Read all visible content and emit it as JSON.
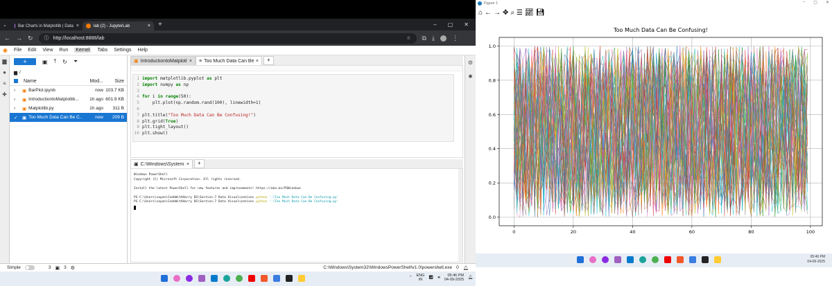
{
  "browser": {
    "tabs": [
      {
        "title": "Bar Charts in Matplotlib | Data",
        "active": false
      },
      {
        "title": "lab (2) - JupyterLab",
        "active": true
      }
    ],
    "new_tab": "+",
    "url": "http://localhost:8888/lab"
  },
  "menu": [
    "File",
    "Edit",
    "View",
    "Run",
    "Kernel",
    "Tabs",
    "Settings",
    "Help"
  ],
  "menu_active": "Kernel",
  "filebrowser": {
    "new_label": "+",
    "path": "/",
    "headers": {
      "name": "Name",
      "modified": "Mod...",
      "size": "Size"
    },
    "files": [
      {
        "name": "BarPlot.ipynb",
        "modified": "now",
        "size": "103.7 KB",
        "selected": false
      },
      {
        "name": "IntroductiontoMatplotlib...",
        "modified": "1h ago",
        "size": "601.9 KB",
        "selected": false
      },
      {
        "name": "Matplotlib.py",
        "modified": "1h ago",
        "size": "311 B",
        "selected": false
      },
      {
        "name": "Too Much Data Can Be C...",
        "modified": "now",
        "size": "209 B",
        "selected": true
      }
    ]
  },
  "notebook_tabs": [
    {
      "title": "IntroductiontoMatplotlib",
      "active": false
    },
    {
      "title": "Too Much Data Can Be C",
      "active": true
    }
  ],
  "code_lines": [
    {
      "n": "1",
      "text": "import matplotlib.pyplot as plt"
    },
    {
      "n": "2",
      "text": "import numpy as np"
    },
    {
      "n": "3",
      "text": ""
    },
    {
      "n": "4",
      "text": "for i in range(50):"
    },
    {
      "n": "5",
      "text": "    plt.plot(np.random.rand(100), linewidth=1)"
    },
    {
      "n": "6",
      "text": ""
    },
    {
      "n": "7",
      "text": "plt.title(\"Too Much Data Can Be Confusing!\")"
    },
    {
      "n": "8",
      "text": "plt.grid(True)"
    },
    {
      "n": "9",
      "text": "plt.tight_layout()"
    },
    {
      "n": "10",
      "text": "plt.show()"
    }
  ],
  "terminal_tab": "C:\\Windows\\System32\\W",
  "terminal_lines": [
    "Windows PowerShell",
    "Copyright (C) Microsoft Corporation. All rights reserved.",
    "",
    "Install the latest PowerShell for new features and improvements! https://aka.ms/PSWindows",
    "",
    "PS C:\\Users\\sayan\\CodeWithHarry DS\\Section-7 Data Visualization> python '.\\Too Much Data Can Be Confusing.py'",
    "PS C:\\Users\\sayan\\CodeWithHarry DS\\Section-7 Data Visualization> python '.\\Too Much Data Can Be Confusing.py'"
  ],
  "statusbar": {
    "mode": "Simple",
    "count1": "3",
    "count2": "3",
    "right": "C:\\Windows\\System32\\WindowsPowerShell\\v1.0\\powershell.exe",
    "right_num": "0"
  },
  "tray": {
    "lang1": "ENG",
    "lang2": "IN",
    "time": "05:46 PM",
    "date": "04-09-2025"
  },
  "figure": {
    "window_title": "Figure 1",
    "taskbar_time": "05:46 PM",
    "taskbar_date": "04-09-2025"
  },
  "chart_data": {
    "type": "line",
    "title": "Too Much Data Can Be Confusing!",
    "xlabel": "",
    "ylabel": "",
    "xlim": [
      0,
      99
    ],
    "ylim": [
      0,
      1
    ],
    "xticks": [
      0,
      20,
      40,
      60,
      80,
      100
    ],
    "yticks": [
      "0.0",
      "0.2",
      "0.4",
      "0.6",
      "0.8",
      "1.0"
    ],
    "grid": true,
    "series_count": 50,
    "points_per_series": 100,
    "colors": [
      "#1f77b4",
      "#ff7f0e",
      "#2ca02c",
      "#d62728",
      "#9467bd",
      "#8c564b",
      "#e377c2",
      "#7f7f7f",
      "#bcbd22",
      "#17becf"
    ]
  }
}
